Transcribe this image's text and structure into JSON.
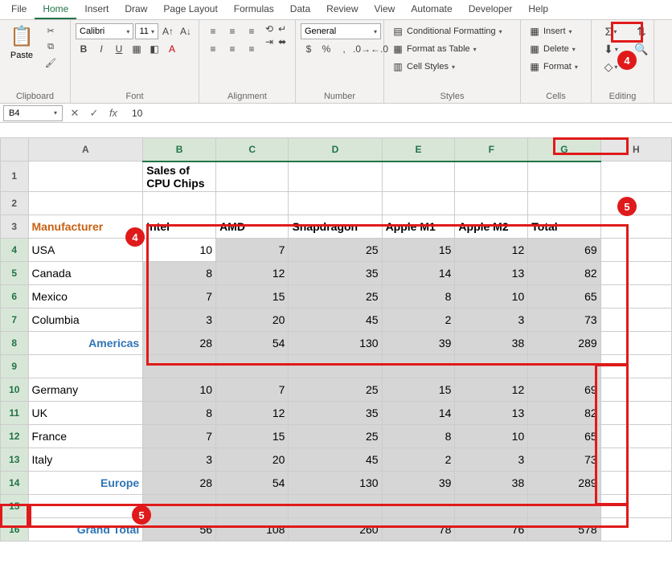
{
  "menubar": [
    "File",
    "Home",
    "Insert",
    "Draw",
    "Page Layout",
    "Formulas",
    "Data",
    "Review",
    "View",
    "Automate",
    "Developer",
    "Help"
  ],
  "menubar_active": 1,
  "ribbon": {
    "clipboard_label": "Clipboard",
    "paste_label": "Paste",
    "font_label": "Font",
    "font_name": "Calibri",
    "font_size": "11",
    "alignment_label": "Alignment",
    "number_label": "Number",
    "number_format": "General",
    "styles_label": "Styles",
    "cond_fmt": "Conditional Formatting",
    "fmt_table": "Format as Table",
    "cell_styles": "Cell Styles",
    "cells_label": "Cells",
    "insert": "Insert",
    "delete": "Delete",
    "format": "Format",
    "editing_label": "Editing"
  },
  "namebox": "B4",
  "formula_value": "10",
  "columns": [
    "A",
    "B",
    "C",
    "D",
    "E",
    "F",
    "G",
    "H"
  ],
  "chart_data": {
    "type": "table",
    "title": "Sales of CPU Chips",
    "header_label": "Manufacturer",
    "columns": [
      "Intel",
      "AMD",
      "Snapdragon",
      "Apple M1",
      "Apple M2",
      "Total"
    ],
    "groups": [
      {
        "name": "Americas",
        "rows": [
          {
            "label": "USA",
            "values": [
              10,
              7,
              25,
              15,
              12,
              69
            ]
          },
          {
            "label": "Canada",
            "values": [
              8,
              12,
              35,
              14,
              13,
              82
            ]
          },
          {
            "label": "Mexico",
            "values": [
              7,
              15,
              25,
              8,
              10,
              65
            ]
          },
          {
            "label": "Columbia",
            "values": [
              3,
              20,
              45,
              2,
              3,
              73
            ]
          }
        ],
        "subtotal": [
          28,
          54,
          130,
          39,
          38,
          289
        ]
      },
      {
        "name": "Europe",
        "rows": [
          {
            "label": "Germany",
            "values": [
              10,
              7,
              25,
              15,
              12,
              69
            ]
          },
          {
            "label": "UK",
            "values": [
              8,
              12,
              35,
              14,
              13,
              82
            ]
          },
          {
            "label": "France",
            "values": [
              7,
              15,
              25,
              8,
              10,
              65
            ]
          },
          {
            "label": "Italy",
            "values": [
              3,
              20,
              45,
              2,
              3,
              73
            ]
          }
        ],
        "subtotal": [
          28,
          54,
          130,
          39,
          38,
          289
        ]
      }
    ],
    "grand_label": "Grand Total",
    "grand_total": [
      56,
      108,
      260,
      78,
      76,
      578
    ]
  }
}
